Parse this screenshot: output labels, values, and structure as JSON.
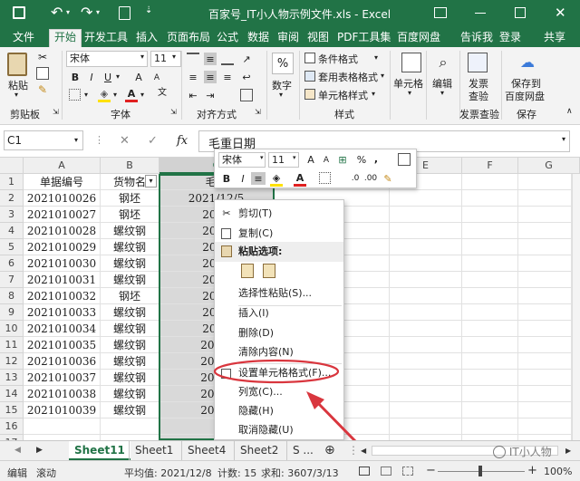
{
  "window": {
    "title": "百家号_IT小人物示例文件.xls - Excel"
  },
  "tabs": [
    "文件",
    "开始",
    "开发工具",
    "插入",
    "页面布局",
    "公式",
    "数据",
    "审阅",
    "视图",
    "PDF工具集",
    "百度网盘"
  ],
  "active_tab": "开始",
  "tell_me": "告诉我",
  "login": "登录",
  "share": "共享",
  "ribbon": {
    "paste": "粘贴",
    "clipboard_group": "剪贴板",
    "font_name": "宋体",
    "font_size": "11",
    "font_group": "字体",
    "align_group": "对齐方式",
    "number": "数字",
    "cond_format": "条件格式",
    "table_format": "套用表格格式",
    "cell_style": "单元格样式",
    "style_group": "样式",
    "cells": "单元格",
    "editing": "编辑",
    "send_check": "发票查验",
    "send_check_lines": [
      "发票",
      "查验"
    ],
    "check_group": "发票查验",
    "save_baidu": "保存到百度网盘",
    "save_baidu_lines": [
      "保存到",
      "百度网盘"
    ],
    "save_group": "保存"
  },
  "formula_bar": {
    "name_box": "C1",
    "fx": "fx",
    "content": "毛重日期"
  },
  "columns": [
    "A",
    "B",
    "C",
    "D",
    "E",
    "F",
    "G"
  ],
  "rows": [
    {
      "n": "1",
      "a": "单据编号",
      "b": "货物名",
      "c": "毛重"
    },
    {
      "n": "2",
      "a": "2021010026",
      "b": "钢坯",
      "c": "2021/12/5"
    },
    {
      "n": "3",
      "a": "2021010027",
      "b": "钢坯",
      "c": "2021"
    },
    {
      "n": "4",
      "a": "2021010028",
      "b": "螺纹钢",
      "c": "2021"
    },
    {
      "n": "5",
      "a": "2021010029",
      "b": "螺纹钢",
      "c": "2021"
    },
    {
      "n": "6",
      "a": "2021010030",
      "b": "螺纹钢",
      "c": "2021"
    },
    {
      "n": "7",
      "a": "2021010031",
      "b": "螺纹钢",
      "c": "2021"
    },
    {
      "n": "8",
      "a": "2021010032",
      "b": "钢坯",
      "c": "2021"
    },
    {
      "n": "9",
      "a": "2021010033",
      "b": "螺纹钢",
      "c": "2021"
    },
    {
      "n": "10",
      "a": "2021010034",
      "b": "螺纹钢",
      "c": "2021"
    },
    {
      "n": "11",
      "a": "2021010035",
      "b": "螺纹钢",
      "c": "2021/"
    },
    {
      "n": "12",
      "a": "2021010036",
      "b": "螺纹钢",
      "c": "2021/"
    },
    {
      "n": "13",
      "a": "2021010037",
      "b": "螺纹钢",
      "c": "2021/"
    },
    {
      "n": "14",
      "a": "2021010038",
      "b": "螺纹钢",
      "c": "2021/"
    },
    {
      "n": "15",
      "a": "2021010039",
      "b": "螺纹钢",
      "c": "2021/"
    },
    {
      "n": "16",
      "a": "",
      "b": "",
      "c": ""
    },
    {
      "n": "17",
      "a": "",
      "b": "",
      "c": ""
    }
  ],
  "mini_toolbar": {
    "font": "宋体",
    "size": "11"
  },
  "context_menu": {
    "cut": "剪切(T)",
    "copy": "复制(C)",
    "paste_options": "粘贴选项:",
    "paste_special": "选择性粘贴(S)...",
    "insert": "插入(I)",
    "delete": "删除(D)",
    "clear": "清除内容(N)",
    "format_cells": "设置单元格格式(F)...",
    "col_width": "列宽(C)...",
    "hide": "隐藏(H)",
    "unhide": "取消隐藏(U)"
  },
  "sheets": [
    "Sheet11",
    "Sheet1",
    "Sheet4",
    "Sheet2",
    "S ..."
  ],
  "active_sheet": "Sheet11",
  "status": {
    "mode": "编辑",
    "scroll": "滚动",
    "average": "平均值: 2021/12/8",
    "count": "计数: 15",
    "sum": "求和: 3607/3/13",
    "zoom": "100%"
  },
  "watermark": "IT小人物",
  "colors": {
    "excel_green": "#217346",
    "annotation_red": "#d9363e"
  }
}
